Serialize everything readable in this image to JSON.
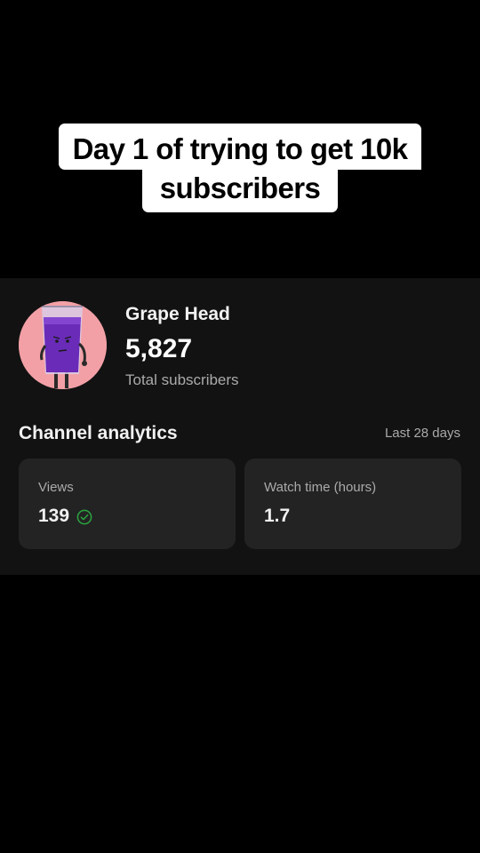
{
  "caption": {
    "line1": "Day 1 of trying to get 10k",
    "line2": "subscribers"
  },
  "channel": {
    "name": "Grape Head",
    "subscriber_count": "5,827",
    "subscriber_label": "Total subscribers",
    "avatar_icon": "grape-juice-cup-character-avatar"
  },
  "analytics": {
    "title": "Channel analytics",
    "period": "Last 28 days",
    "cards": [
      {
        "label": "Views",
        "value": "139",
        "status_icon": "check-circle-icon"
      },
      {
        "label": "Watch time (hours)",
        "value": "1.7"
      }
    ]
  },
  "colors": {
    "background": "#000000",
    "panel": "#121212",
    "card": "#232323",
    "avatar_bg": "#f2a0a6",
    "grape": "#6a2bb8",
    "check_green": "#2ba640"
  }
}
